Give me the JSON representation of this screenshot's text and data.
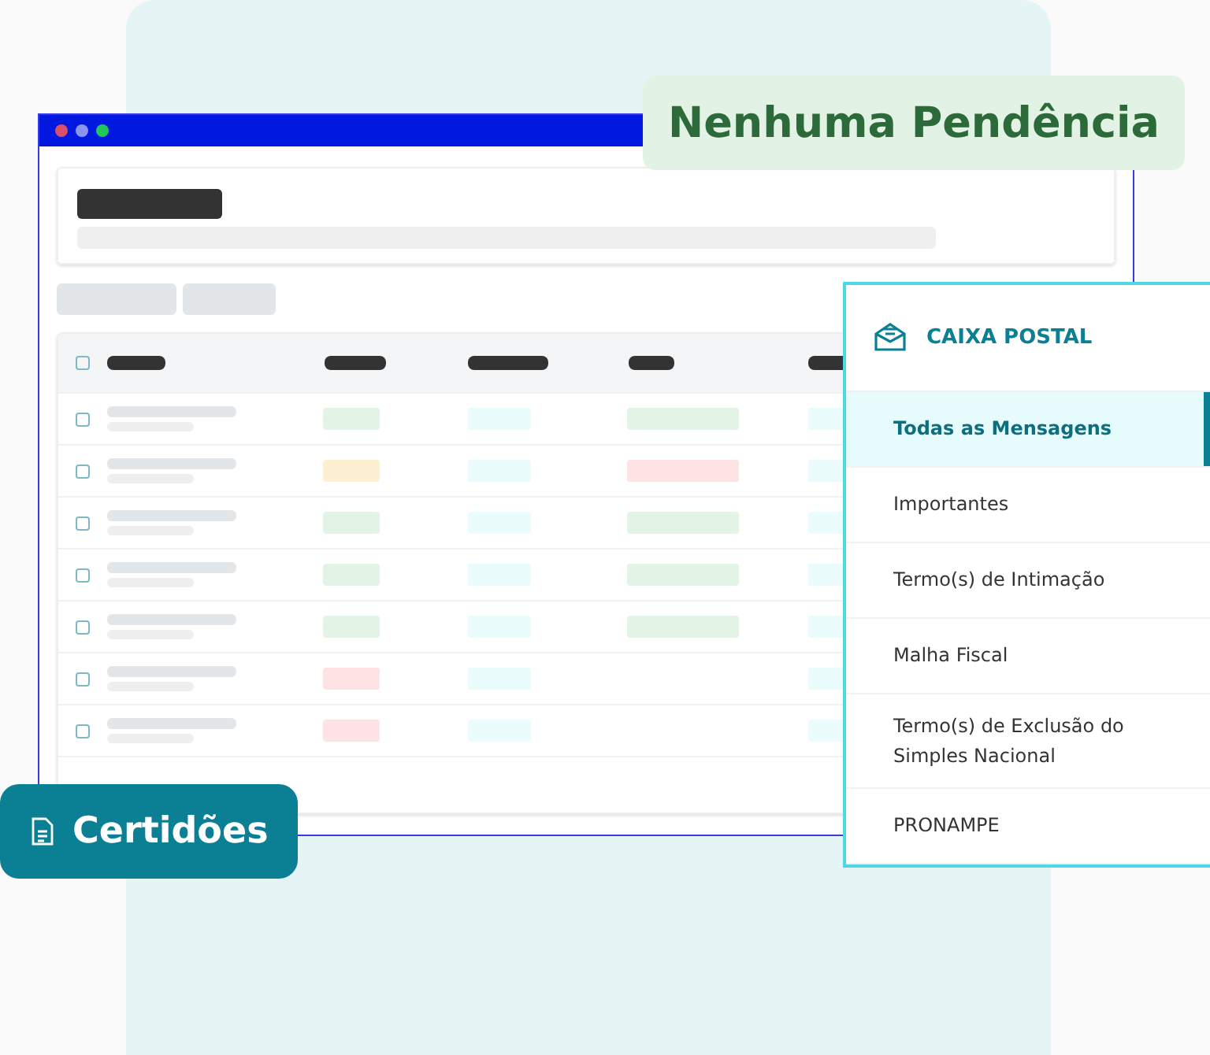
{
  "status_badge": {
    "label": "Nenhuma Pendência"
  },
  "table": {
    "header_checkbox": {
      "checked": false
    },
    "rows": [
      {
        "checked": false,
        "tags": [
          {
            "color": "#e2f4e6"
          },
          {
            "color": "#eafcfc"
          },
          {
            "color": "#e2f4e6"
          },
          {
            "color": "#eafcfc"
          }
        ]
      },
      {
        "checked": false,
        "tags": [
          {
            "color": "#fdefd2"
          },
          {
            "color": "#eafcfc"
          },
          {
            "color": "#fde3e3"
          },
          {
            "color": "#eafcfc"
          }
        ]
      },
      {
        "checked": false,
        "tags": [
          {
            "color": "#e2f4e6"
          },
          {
            "color": "#eafcfc"
          },
          {
            "color": "#e2f4e6"
          },
          {
            "color": "#eafcfc"
          }
        ]
      },
      {
        "checked": false,
        "tags": [
          {
            "color": "#e2f4e6"
          },
          {
            "color": "#eafcfc"
          },
          {
            "color": "#e2f4e6"
          },
          {
            "color": "#eafcfc"
          }
        ]
      },
      {
        "checked": false,
        "tags": [
          {
            "color": "#e2f4e6"
          },
          {
            "color": "#eafcfc"
          },
          {
            "color": "#e2f4e6"
          },
          {
            "color": "#eafcfc"
          }
        ]
      },
      {
        "checked": false,
        "tags": [
          {
            "color": "#fde3e3"
          },
          {
            "color": "#eafcfc"
          },
          {
            "color": "#eafcfc"
          }
        ]
      },
      {
        "checked": false,
        "tags": [
          {
            "color": "#fde3e3"
          },
          {
            "color": "#eafcfc"
          },
          {
            "color": "#eafcfc"
          }
        ]
      }
    ]
  },
  "mailbox": {
    "title": "CAIXA POSTAL",
    "items": [
      {
        "label": "Todas as Mensagens",
        "selected": true
      },
      {
        "label": "Importantes",
        "selected": false
      },
      {
        "label": "Termo(s) de Intimação",
        "selected": false
      },
      {
        "label": "Malha Fiscal",
        "selected": false
      },
      {
        "label": "Termo(s) de Exclusão do Simples Nacional",
        "selected": false
      },
      {
        "label": "PRONAMPE",
        "selected": false
      }
    ]
  },
  "certificates_badge": {
    "label": "Certidões"
  }
}
